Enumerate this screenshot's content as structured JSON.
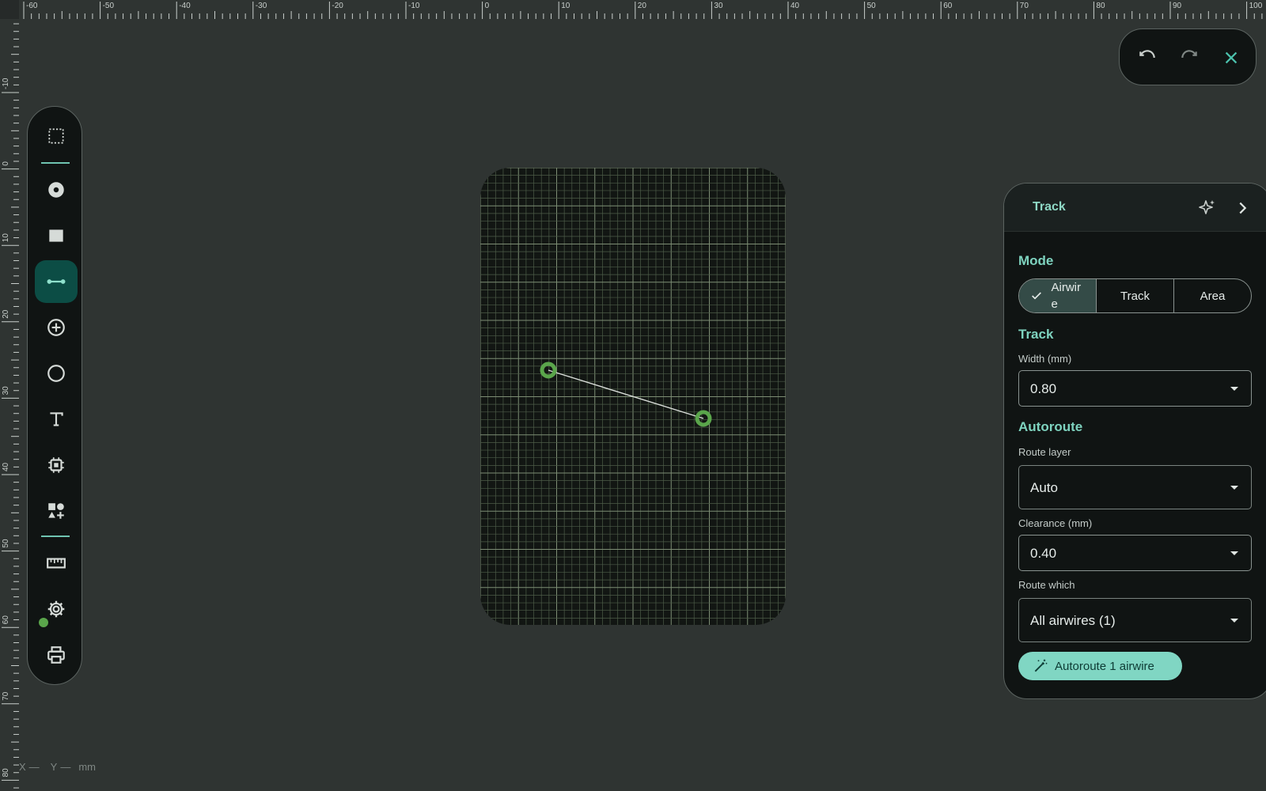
{
  "ruler": {
    "top_labels": [
      "-60",
      "-50",
      "-40",
      "-30",
      "-20",
      "-10",
      "0",
      "10",
      "20",
      "30",
      "40",
      "50",
      "60",
      "70",
      "80",
      "90",
      "100"
    ],
    "left_labels": [
      "-10",
      "0",
      "10",
      "20",
      "30",
      "40",
      "50",
      "60",
      "70",
      "80"
    ]
  },
  "toolbar": {
    "tools": [
      {
        "name": "select-tool",
        "icon": "dashed-selection-icon"
      },
      {
        "name": "pad-tool",
        "icon": "circle-pad-icon"
      },
      {
        "name": "rect-pad-tool",
        "icon": "square-icon"
      },
      {
        "name": "track-tool",
        "icon": "track-line-icon",
        "active": true
      },
      {
        "name": "via-tool",
        "icon": "add-circle-icon"
      },
      {
        "name": "circle-tool",
        "icon": "circle-outline-icon"
      },
      {
        "name": "text-tool",
        "icon": "text-icon"
      },
      {
        "name": "component-tool",
        "icon": "chip-icon"
      },
      {
        "name": "shapes-tool",
        "icon": "shapes-icon"
      },
      {
        "name": "measure-tool",
        "icon": "ruler-icon"
      },
      {
        "name": "settings-tool",
        "icon": "gear-icon"
      },
      {
        "name": "print-tool",
        "icon": "printer-icon"
      }
    ]
  },
  "history": {
    "undo_icon": "undo-icon",
    "redo_icon": "redo-icon",
    "close_icon": "close-icon"
  },
  "panel": {
    "title": "Track",
    "mode_title": "Mode",
    "mode_options": [
      "Airwire",
      "Track",
      "Area"
    ],
    "mode_selected": "Airwire",
    "track_title": "Track",
    "width_label": "Width (mm)",
    "width_value": "0.80",
    "autoroute_title": "Autoroute",
    "route_layer_label": "Route layer",
    "route_layer_value": "Auto",
    "clearance_label": "Clearance (mm)",
    "clearance_value": "0.40",
    "route_which_label": "Route which",
    "route_which_value": "All airwires (1)",
    "autoroute_button": "Autoroute 1 airwire"
  },
  "coords": {
    "x_label": "X",
    "x_value": "—",
    "y_label": "Y",
    "y_value": "—",
    "unit": "mm"
  },
  "colors": {
    "accent": "#80d6c3",
    "board": "#121613",
    "grid": "#5e6e58",
    "pad": "#5aa54b",
    "airwire": "#d9ddd9"
  }
}
